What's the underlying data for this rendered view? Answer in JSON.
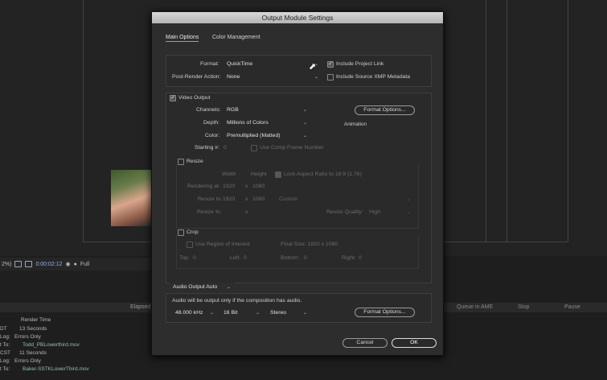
{
  "dialog": {
    "title": "Output Module Settings",
    "tabs": [
      "Main Options",
      "Color Management"
    ],
    "format_label": "Format:",
    "format_value": "QuickTime",
    "include_project_link": "Include Project Link",
    "post_render_label": "Post-Render Action:",
    "post_render_value": "None",
    "include_xmp": "Include Source XMP Metadata",
    "video_output": "Video Output",
    "channels_label": "Channels:",
    "channels_value": "RGB",
    "format_options": "Format Options...",
    "depth_label": "Depth:",
    "depth_value": "Millions of Colors",
    "codec_note": "Animation",
    "color_label": "Color:",
    "color_value": "Premultiplied (Matted)",
    "starting_label": "Starting #:",
    "starting_value": "0",
    "use_comp_frame": "Use Comp Frame Number",
    "resize": "Resize",
    "width_hdr": "Width",
    "height_hdr": "Height",
    "lock_aspect": "Lock Aspect Ratio to 16:9 (1.78)",
    "rendering_at_label": "Rendering at:",
    "rendering_w": "1920",
    "rendering_h": "1080",
    "resize_to_label": "Resize to:",
    "resize_to_w": "1920",
    "resize_to_h": "1080",
    "resize_to_preset": "Custom",
    "resize_pct_label": "Resize %:",
    "x_sep": "x",
    "resize_quality_label": "Resize Quality:",
    "resize_quality_value": "High",
    "crop": "Crop",
    "use_roi": "Use Region of Interest",
    "final_size": "Final Size: 1920 x 1080",
    "top_label": "Top:",
    "top_value": "0",
    "left_label": "Left:",
    "left_value": "0",
    "bottom_label": "Bottom:",
    "bottom_value": "0",
    "right_label": "Right:",
    "right_value": "0",
    "audio_output": "Audio Output Auto",
    "audio_note": "Audio will be output only if the composition has audio.",
    "sample_rate": "48.000 kHz",
    "bit_depth": "16 Bit",
    "channels_audio": "Stereo",
    "audio_format_options": "Format Options...",
    "cancel": "Cancel",
    "ok": "OK"
  },
  "background": {
    "zoom": "2%)",
    "timecode": "0:00:02:12",
    "resolution": "Full",
    "elapsed": "Elapsed:",
    "queue_ame": "Queue in AME",
    "stop": "Stop",
    "pause": "Pause",
    "render_time_hdr": "Render Time",
    "rows": [
      {
        "prefix": "DT",
        "text": "13 Seconds"
      },
      {
        "prefix": "Log:",
        "text": "Errors Only"
      },
      {
        "prefix": "t To:",
        "text": "Todd_PBLowerthird.mov"
      },
      {
        "prefix": "CST",
        "text": "11 Seconds"
      },
      {
        "prefix": "Log:",
        "text": "Errors Only"
      },
      {
        "prefix": "t To:",
        "text": "Baker-SSTKLowerThird.mov"
      }
    ]
  }
}
